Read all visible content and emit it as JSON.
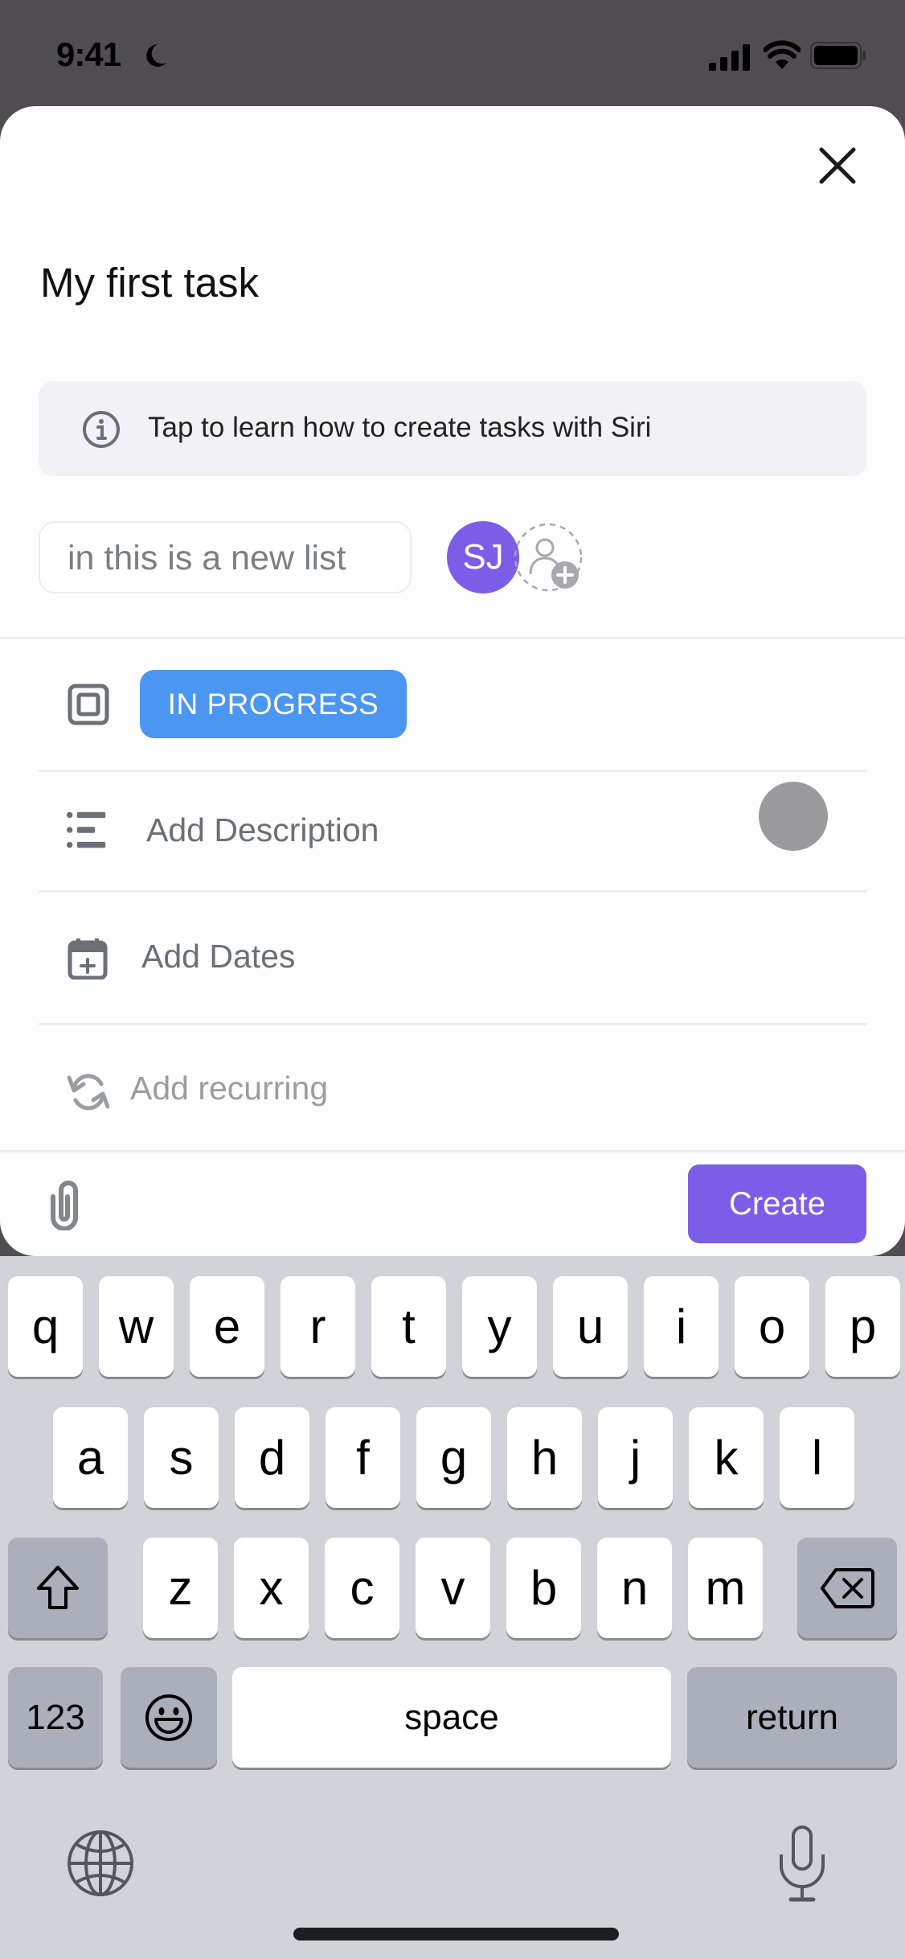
{
  "status_bar": {
    "time": "9:41",
    "icons": [
      "moon-icon",
      "signal-icon",
      "wifi-icon",
      "battery-icon"
    ]
  },
  "sheet": {
    "title": "My first task",
    "close_icon": "close-icon",
    "siri_banner": {
      "icon": "info-icon",
      "text": "Tap to learn how to create tasks with Siri"
    },
    "list_chip": "in this is a new list",
    "assignee": {
      "initials": "SJ",
      "color": "#7b5de8"
    },
    "add_assignee_icon": "add-user-icon",
    "rows": [
      {
        "icon": "status-square-icon",
        "status_label": "IN PROGRESS",
        "status_color": "#4a96f0"
      },
      {
        "icon": "description-list-icon",
        "label": "Add Description"
      },
      {
        "icon": "calendar-plus-icon",
        "label": "Add Dates"
      },
      {
        "icon": "recurring-icon",
        "label": "Add recurring"
      }
    ],
    "footer": {
      "attach_icon": "paperclip-icon",
      "create_label": "Create",
      "create_color": "#7b5de8"
    }
  },
  "keyboard": {
    "row1": [
      "q",
      "w",
      "e",
      "r",
      "t",
      "y",
      "u",
      "i",
      "o",
      "p"
    ],
    "row2": [
      "a",
      "s",
      "d",
      "f",
      "g",
      "h",
      "j",
      "k",
      "l"
    ],
    "row3": [
      "z",
      "x",
      "c",
      "v",
      "b",
      "n",
      "m"
    ],
    "numbers_label": "123",
    "space_label": "space",
    "return_label": "return",
    "icons": [
      "shift-icon",
      "backspace-icon",
      "emoji-icon",
      "globe-icon",
      "microphone-icon"
    ]
  }
}
